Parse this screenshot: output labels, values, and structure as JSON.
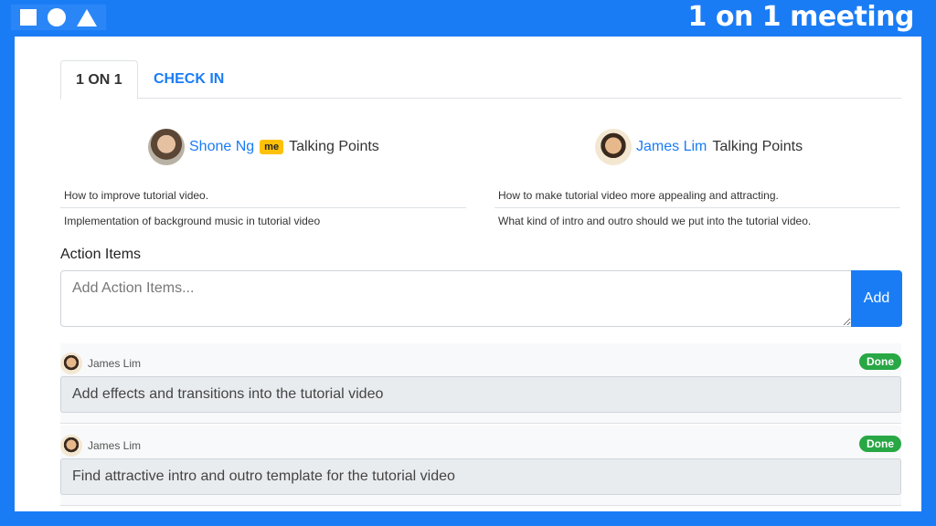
{
  "header": {
    "title": "1 on 1 meeting",
    "shapes": [
      "square",
      "circle",
      "triangle"
    ]
  },
  "tabs": [
    {
      "label": "1 ON 1",
      "active": true
    },
    {
      "label": "CHECK IN",
      "active": false
    }
  ],
  "people": [
    {
      "name": "Shone Ng",
      "badge": "me",
      "suffix": "Talking Points",
      "talking_points": [
        "How to improve tutorial video.",
        "Implementation of background music in tutorial video"
      ]
    },
    {
      "name": "James Lim",
      "badge": "",
      "suffix": "Talking Points",
      "talking_points": [
        "How to make tutorial video more appealing and attracting.",
        "What kind of intro and outro should we put into the tutorial video."
      ]
    }
  ],
  "action_items": {
    "label": "Action Items",
    "placeholder": "Add Action Items...",
    "add_label": "Add",
    "items": [
      {
        "owner": "James Lim",
        "status": "Done",
        "text": "Add effects and transitions into the tutorial video"
      },
      {
        "owner": "James Lim",
        "status": "Done",
        "text": "Find attractive intro and outro template for the tutorial video"
      }
    ]
  },
  "colors": {
    "brand": "#1a7cf5",
    "me_badge": "#ffc107",
    "done_badge": "#28a745"
  }
}
